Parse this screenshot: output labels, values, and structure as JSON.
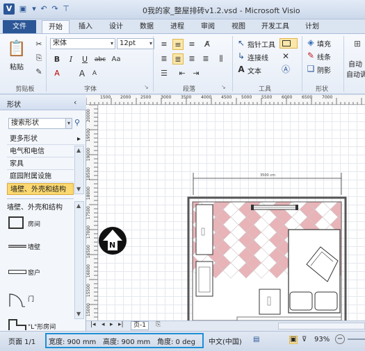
{
  "window": {
    "title": "0我的家_整屋排砖v1.2.vsd - Microsoft Visio"
  },
  "tabs": [
    "开始",
    "插入",
    "设计",
    "数据",
    "进程",
    "审阅",
    "视图",
    "开发工具",
    "计划"
  ],
  "file_tab": "文件",
  "ribbon": {
    "clipboard": {
      "label": "剪贴板",
      "paste": "粘贴"
    },
    "font": {
      "label": "字体",
      "name": "宋体",
      "size": "12pt",
      "bold": "B",
      "italic": "I",
      "underline": "U",
      "strike": "abc",
      "case": "Aa",
      "grow": "A",
      "shrink": "A"
    },
    "paragraph": {
      "label": "段落"
    },
    "tools": {
      "label": "工具",
      "pointer": "指针工具",
      "connector": "连接线",
      "text": "文本"
    },
    "shape": {
      "label": "形状",
      "fill": "填充",
      "line": "线条",
      "shadow": "阴影"
    },
    "more": {
      "auto1": "自动",
      "auto2": "自动调"
    }
  },
  "shapes_panel": {
    "title": "形状",
    "search_placeholder": "搜索形状",
    "more_shapes": "更多形状",
    "stencils": [
      "电气和电信",
      "家具",
      "庭园附属设施",
      "墙壁、外壳和结构"
    ],
    "active_stencil": "墙壁、外壳和结构",
    "stencil_title": "墙壁、外壳和结构",
    "items": [
      {
        "label": "房间",
        "icon": "room-icon"
      },
      {
        "label": "墙壁",
        "icon": "wall-icon"
      },
      {
        "label": "窗户",
        "icon": "window-icon"
      },
      {
        "label": "门",
        "icon": "door-icon"
      },
      {
        "label": "\"L\"形房间",
        "icon": "l-room-icon"
      }
    ]
  },
  "ruler_top": [
    "1500",
    "2000",
    "2500",
    "3000",
    "3500",
    "4000",
    "4500",
    "5000",
    "5500",
    "6000",
    "6500",
    "7000"
  ],
  "ruler_left": [
    "20000",
    "19500",
    "19000",
    "18500",
    "18000",
    "17500",
    "17000",
    "16500",
    "16000",
    "15500",
    "15000"
  ],
  "canvas": {
    "compass": "N",
    "dimension": "3500 cm"
  },
  "pagebar": {
    "page_tab": "页-1"
  },
  "statusbar": {
    "page": "页面 1/1",
    "width": "宽度: 900 mm",
    "height": "高度: 900 mm",
    "angle": "角度: 0 deg",
    "language": "中文(中国)",
    "zoom": "93%"
  }
}
